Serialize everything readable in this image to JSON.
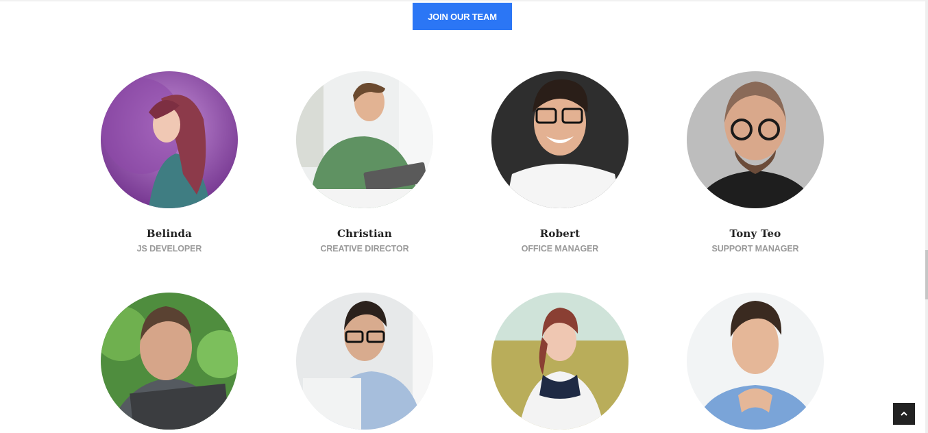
{
  "header": {
    "join_button_label": "JOIN OUR TEAM"
  },
  "team": [
    {
      "name": "Belinda",
      "role": "JS DEVELOPER"
    },
    {
      "name": "Christian",
      "role": "CREATIVE DIRECTOR"
    },
    {
      "name": "Robert",
      "role": "OFFICE MANAGER"
    },
    {
      "name": "Tony Teo",
      "role": "SUPPORT MANAGER"
    },
    {
      "name": "",
      "role": ""
    },
    {
      "name": "",
      "role": ""
    },
    {
      "name": "",
      "role": ""
    },
    {
      "name": "",
      "role": ""
    }
  ],
  "back_to_top": {
    "icon": "chevron-up-icon"
  },
  "colors": {
    "accent": "#2b76f5",
    "name_text": "#222222",
    "role_text": "#9a9a9a",
    "back_top_bg": "#222222"
  }
}
